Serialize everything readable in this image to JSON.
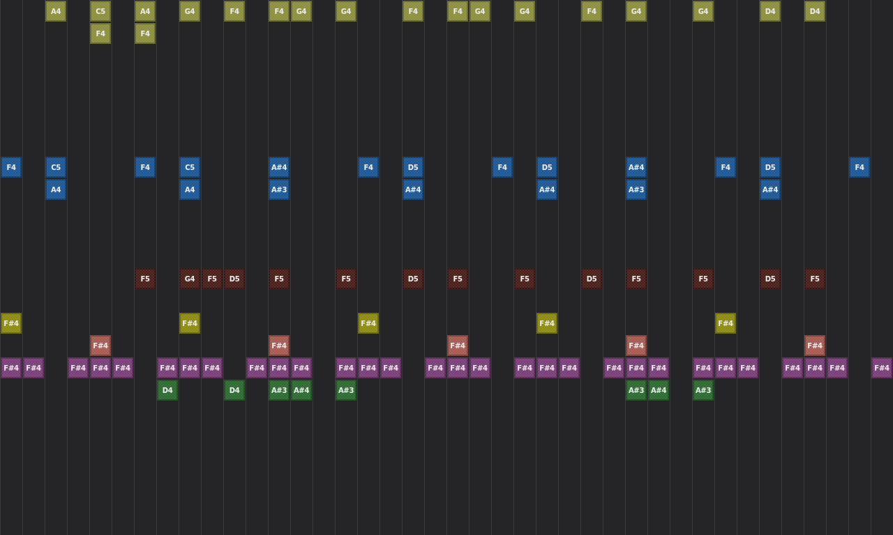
{
  "rows": [
    {
      "color": "#8c8f3e",
      "cells": [
        null,
        null,
        "A4",
        null,
        "C5",
        null,
        "A4",
        null,
        "G4",
        null,
        "F4",
        null,
        "F4",
        "G4",
        null,
        "G4",
        null,
        null,
        "F4",
        null,
        "F4",
        "G4",
        null,
        "G4",
        null,
        null,
        "F4",
        null,
        "G4",
        null,
        null,
        "G4",
        null,
        null,
        "D4",
        null,
        "D4",
        null,
        null,
        null
      ]
    },
    {
      "color": "#8c8f3e",
      "cells": [
        null,
        null,
        null,
        null,
        "F4",
        null,
        "F4",
        null,
        null,
        null,
        null,
        null,
        null,
        null,
        null,
        null,
        null,
        null,
        null,
        null,
        null,
        null,
        null,
        null,
        null,
        null,
        null,
        null,
        null,
        null,
        null,
        null,
        null,
        null,
        null,
        null,
        null,
        null,
        null,
        null
      ]
    },
    {},
    {},
    {},
    {},
    {},
    {
      "color": "#1d5794",
      "cells": [
        "F4",
        null,
        "C5",
        null,
        null,
        null,
        "F4",
        null,
        "C5",
        null,
        null,
        null,
        "A#4",
        null,
        null,
        null,
        "F4",
        null,
        "D5",
        null,
        null,
        null,
        "F4",
        null,
        "D5",
        null,
        null,
        null,
        "A#4",
        null,
        null,
        null,
        "F4",
        null,
        "D5",
        null,
        null,
        null,
        "F4",
        null
      ]
    },
    {
      "color": "#1d5794",
      "cells": [
        null,
        null,
        "A4",
        null,
        null,
        null,
        null,
        null,
        "A4",
        null,
        null,
        null,
        "A#3",
        null,
        null,
        null,
        null,
        null,
        "A#4",
        null,
        null,
        null,
        null,
        null,
        "A#4",
        null,
        null,
        null,
        "A#3",
        null,
        null,
        null,
        null,
        null,
        "A#4",
        null,
        null,
        null,
        null,
        null
      ]
    },
    {},
    {},
    {},
    {
      "color": "#4a1f1a",
      "cells": [
        null,
        null,
        null,
        null,
        null,
        null,
        "F5",
        null,
        "G4",
        "F5",
        "D5",
        null,
        "F5",
        null,
        null,
        "F5",
        null,
        null,
        "D5",
        null,
        "F5",
        null,
        null,
        "F5",
        null,
        null,
        "D5",
        null,
        "F5",
        null,
        null,
        "F5",
        null,
        null,
        "D5",
        null,
        "F5",
        null,
        null,
        null
      ]
    },
    {},
    {
      "color": "#8e8c10",
      "cells": [
        "F#4",
        null,
        null,
        null,
        null,
        null,
        null,
        null,
        "F#4",
        null,
        null,
        null,
        null,
        null,
        null,
        null,
        "F#4",
        null,
        null,
        null,
        null,
        null,
        null,
        null,
        "F#4",
        null,
        null,
        null,
        null,
        null,
        null,
        null,
        "F#4",
        null,
        null,
        null,
        null,
        null,
        null,
        null
      ]
    },
    {
      "color": "#a65a52",
      "cells": [
        null,
        null,
        null,
        null,
        "F#4",
        null,
        null,
        null,
        null,
        null,
        null,
        null,
        "F#4",
        null,
        null,
        null,
        null,
        null,
        null,
        null,
        "F#4",
        null,
        null,
        null,
        null,
        null,
        null,
        null,
        "F#4",
        null,
        null,
        null,
        null,
        null,
        null,
        null,
        "F#4",
        null,
        null,
        null
      ]
    },
    {
      "color": "#7a3e78",
      "cells": [
        "F#4",
        "F#4",
        null,
        "F#4",
        "F#4",
        "F#4",
        null,
        "F#4",
        "F#4",
        "F#4",
        null,
        "F#4",
        "F#4",
        "F#4",
        null,
        "F#4",
        "F#4",
        "F#4",
        null,
        "F#4",
        "F#4",
        "F#4",
        null,
        "F#4",
        "F#4",
        "F#4",
        null,
        "F#4",
        "F#4",
        "F#4",
        null,
        "F#4",
        "F#4",
        "F#4",
        null,
        "F#4",
        "F#4",
        "F#4",
        null,
        "F#4"
      ]
    },
    {
      "color": "#2e6b32",
      "cells": [
        null,
        null,
        null,
        null,
        null,
        null,
        null,
        "D4",
        null,
        null,
        "D4",
        null,
        "A#3",
        "A#4",
        null,
        "A#3",
        null,
        null,
        null,
        null,
        null,
        null,
        null,
        null,
        null,
        null,
        null,
        null,
        "A#3",
        "A#4",
        null,
        "A#3",
        null,
        null,
        null,
        null,
        null,
        null,
        null,
        null
      ]
    },
    {},
    {},
    {},
    {},
    {},
    {}
  ]
}
